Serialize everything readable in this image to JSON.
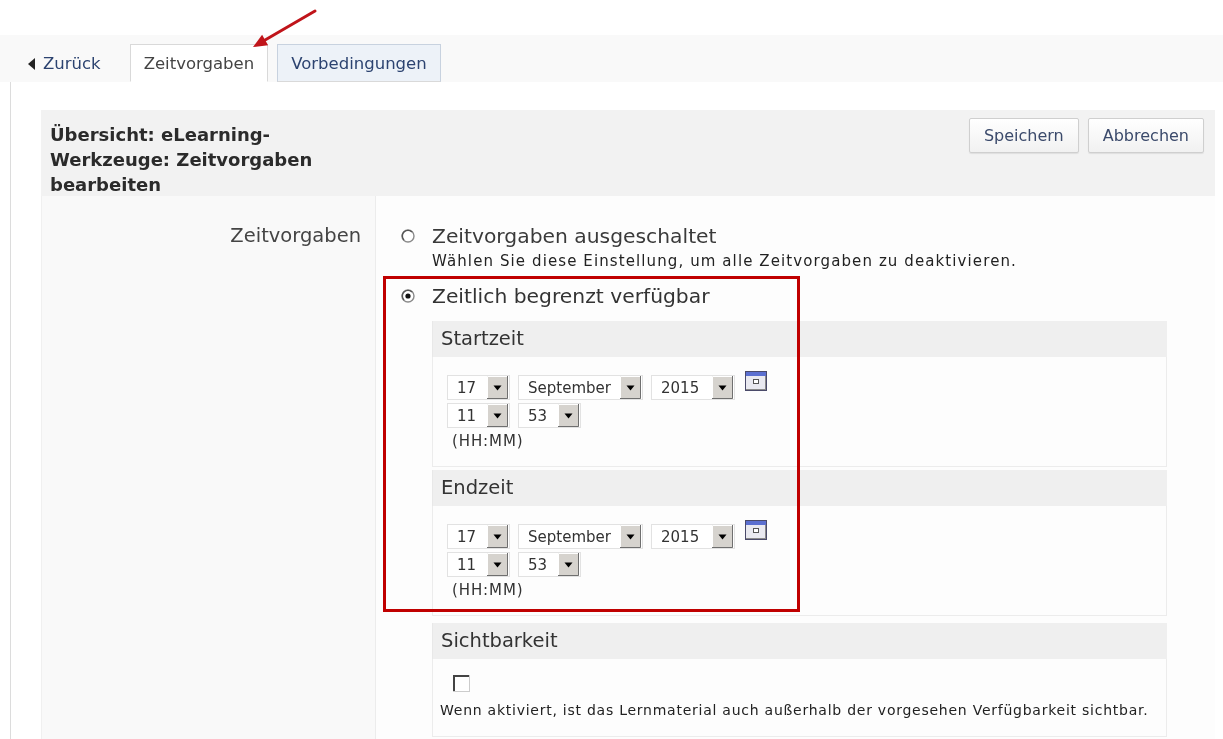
{
  "tabs": [
    {
      "kind": "back",
      "label": "Zurück",
      "selected": false,
      "annotated": false
    },
    {
      "kind": "tab",
      "label": "Zeitvorgaben",
      "selected": true,
      "annotated": true
    },
    {
      "kind": "tab",
      "label": "Vorbedingungen",
      "selected": false,
      "annotated": false
    }
  ],
  "header": {
    "title": "Übersicht: eLearning-Werkzeuge: Zeitvorgaben bearbeiten",
    "buttons": [
      "Speichern",
      "Abbrechen"
    ]
  },
  "form": {
    "label": "Zeitvorgaben",
    "options": [
      {
        "label": "Zeitvorgaben ausgeschaltet",
        "hint": "Wählen Sie diese Einstellung, um alle Zeitvorgaben zu deaktivieren.",
        "selected": false,
        "highlighted": false
      },
      {
        "label": "Zeitlich begrenzt verfügbar",
        "selected": true,
        "highlighted": true,
        "sections": [
          {
            "title": "Startzeit",
            "day": "17",
            "month": "September",
            "year": "2015",
            "hour": "11",
            "minute": "53",
            "format": "(HH:MM)"
          },
          {
            "title": "Endzeit",
            "day": "17",
            "month": "September",
            "year": "2015",
            "hour": "11",
            "minute": "53",
            "format": "(HH:MM)"
          }
        ]
      }
    ],
    "visibility": {
      "title": "Sichtbarkeit",
      "checked": false,
      "description": "Wenn aktiviert, ist das Lernmaterial auch außerhalb der vorgesehen Verfügbarkeit sichtbar."
    }
  }
}
